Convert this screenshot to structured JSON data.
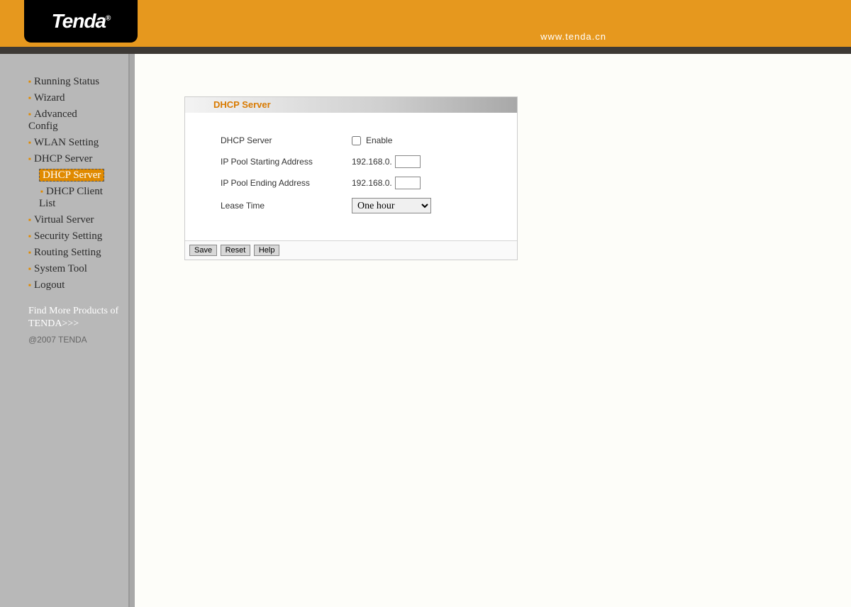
{
  "header": {
    "logo_text": "Tenda",
    "url": "www.tenda.cn"
  },
  "sidebar": {
    "items": [
      {
        "label": "Running Status"
      },
      {
        "label": "Wizard"
      },
      {
        "label": "Advanced Config"
      },
      {
        "label": "WLAN Setting"
      },
      {
        "label": "DHCP Server",
        "children": [
          {
            "label": "DHCP Server",
            "active": true
          },
          {
            "label": "DHCP Client List"
          }
        ]
      },
      {
        "label": "Virtual Server"
      },
      {
        "label": "Security Setting"
      },
      {
        "label": "Routing Setting"
      },
      {
        "label": "System Tool"
      },
      {
        "label": "Logout"
      }
    ],
    "promo": "Find More Products of TENDA>>>",
    "copyright": "@2007 TENDA"
  },
  "panel": {
    "title": "DHCP Server",
    "fields": {
      "dhcp_label": "DHCP Server",
      "enable_label": "Enable",
      "enable_checked": false,
      "ip_start_label": "IP Pool Starting Address",
      "ip_start_prefix": "192.168.0.",
      "ip_start_value": "",
      "ip_end_label": "IP Pool Ending Address",
      "ip_end_prefix": "192.168.0.",
      "ip_end_value": "",
      "lease_label": "Lease Time",
      "lease_selected": "One hour",
      "lease_options": [
        "One hour"
      ]
    },
    "buttons": {
      "save": "Save",
      "reset": "Reset",
      "help": "Help"
    }
  }
}
